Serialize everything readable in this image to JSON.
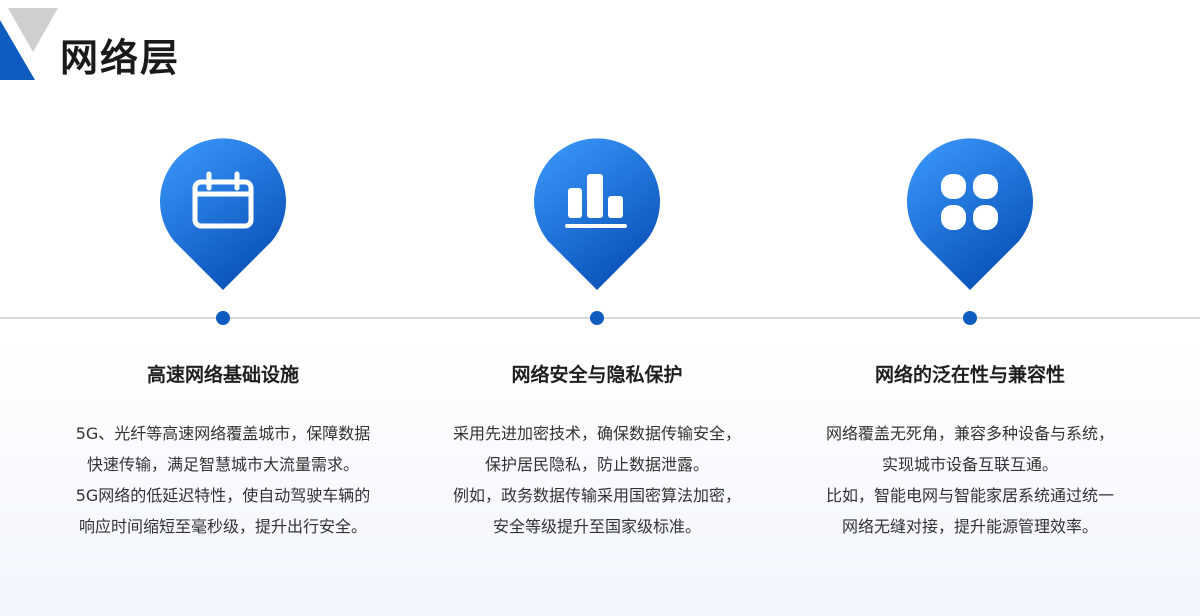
{
  "page": {
    "title": "网络层",
    "accent_color": "#0f5cc0",
    "accent_light": "#3d9bff"
  },
  "features": [
    {
      "icon": "calendar-icon",
      "title": "高速网络基础设施",
      "lines": [
        "5G、光纤等高速网络覆盖城市，保障数据",
        "快速传输，满足智慧城市大流量需求。",
        "5G网络的低延迟特性，使自动驾驶车辆的",
        "响应时间缩短至毫秒级，提升出行安全。"
      ]
    },
    {
      "icon": "bar-chart-icon",
      "title": "网络安全与隐私保护",
      "lines": [
        "采用先进加密技术，确保数据传输安全，",
        "保护居民隐私，防止数据泄露。",
        "例如，政务数据传输采用国密算法加密，",
        "安全等级提升至国家级标准。"
      ]
    },
    {
      "icon": "grid-clover-icon",
      "title": "网络的泛在性与兼容性",
      "lines": [
        "网络覆盖无死角，兼容多种设备与系统，",
        "实现城市设备互联互通。",
        "比如，智能电网与智能家居系统通过统一",
        "网络无缝对接，提升能源管理效率。"
      ]
    }
  ]
}
